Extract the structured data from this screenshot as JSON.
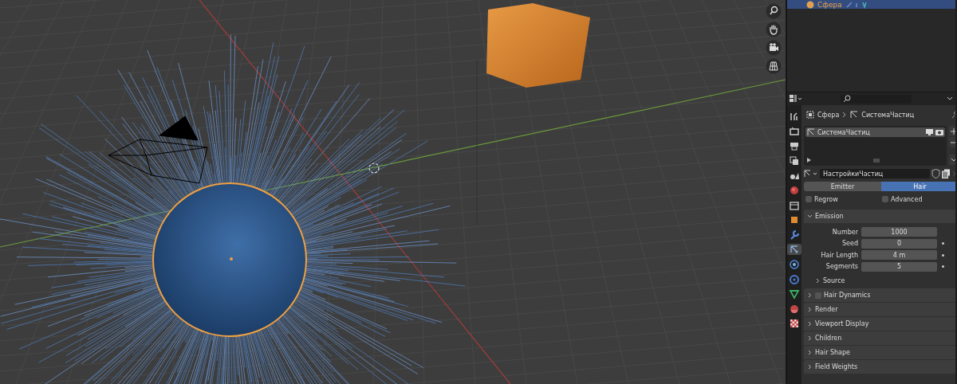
{
  "outliner": {
    "rows": [
      {
        "label": "Сфера",
        "selected": true
      }
    ]
  },
  "properties": {
    "tabs": [
      {
        "kind": "tool",
        "selected": false
      },
      {
        "kind": "render",
        "selected": false
      },
      {
        "kind": "output",
        "selected": false
      },
      {
        "kind": "view_layer",
        "selected": false
      },
      {
        "kind": "scene",
        "selected": false
      },
      {
        "kind": "world",
        "selected": false
      },
      {
        "kind": "collection",
        "selected": false
      },
      {
        "kind": "object",
        "selected": false
      },
      {
        "kind": "modifier",
        "selected": false
      },
      {
        "kind": "particles",
        "selected": true
      },
      {
        "kind": "physics",
        "selected": false
      },
      {
        "kind": "constraints",
        "selected": false
      },
      {
        "kind": "data",
        "selected": false
      },
      {
        "kind": "material",
        "selected": false
      },
      {
        "kind": "texture",
        "selected": false
      }
    ],
    "breadcrumb": [
      "Сфера",
      "СистемаЧастиц"
    ],
    "particle_systems": [
      {
        "name": "СистемаЧастиц",
        "selected": true
      }
    ],
    "settings_name": "НастройкиЧастиц",
    "type_toggle": [
      {
        "label": "Emitter",
        "selected": false
      },
      {
        "label": "Hair",
        "selected": true
      }
    ],
    "options": [
      {
        "label": "Regrow",
        "checked": false
      },
      {
        "label": "Advanced",
        "checked": false
      }
    ],
    "emission": {
      "title": "Emission",
      "expanded": true,
      "fields": [
        {
          "label": "Number",
          "value": "1000",
          "keyable": false
        },
        {
          "label": "Seed",
          "value": "0",
          "keyable": true
        },
        {
          "label": "Hair Length",
          "value": "4 m",
          "keyable": true
        },
        {
          "label": "Segments",
          "value": "5",
          "keyable": true
        }
      ],
      "subpanels": [
        {
          "title": "Source",
          "expanded": false
        }
      ]
    },
    "panels": [
      {
        "title": "Hair Dynamics",
        "expanded": false,
        "checked": false
      },
      {
        "title": "Render",
        "expanded": false
      },
      {
        "title": "Viewport Display",
        "expanded": false
      },
      {
        "title": "Children",
        "expanded": false
      },
      {
        "title": "Hair Shape",
        "expanded": false
      },
      {
        "title": "Field Weights",
        "expanded": false
      }
    ]
  }
}
